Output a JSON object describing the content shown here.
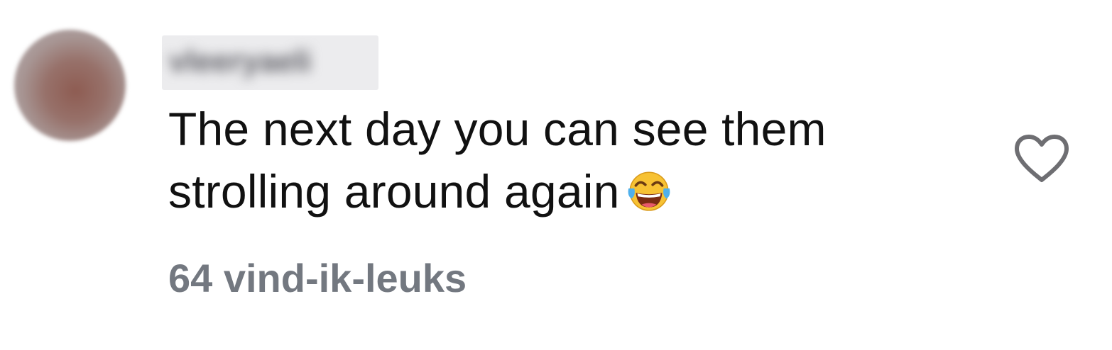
{
  "comment": {
    "username": "vleeryaeli",
    "text": "The next day you can see them strolling around again",
    "emoji": "face-with-tears-of-joy-icon",
    "likes_label": "64 vind-ik-leuks"
  },
  "icons": {
    "like": "heart-outline-icon"
  },
  "colors": {
    "text": "#111111",
    "meta": "#737880",
    "heart_stroke": "#6e6e72",
    "emoji_face": "#f7c233",
    "emoji_tears": "#4fb0ec"
  }
}
